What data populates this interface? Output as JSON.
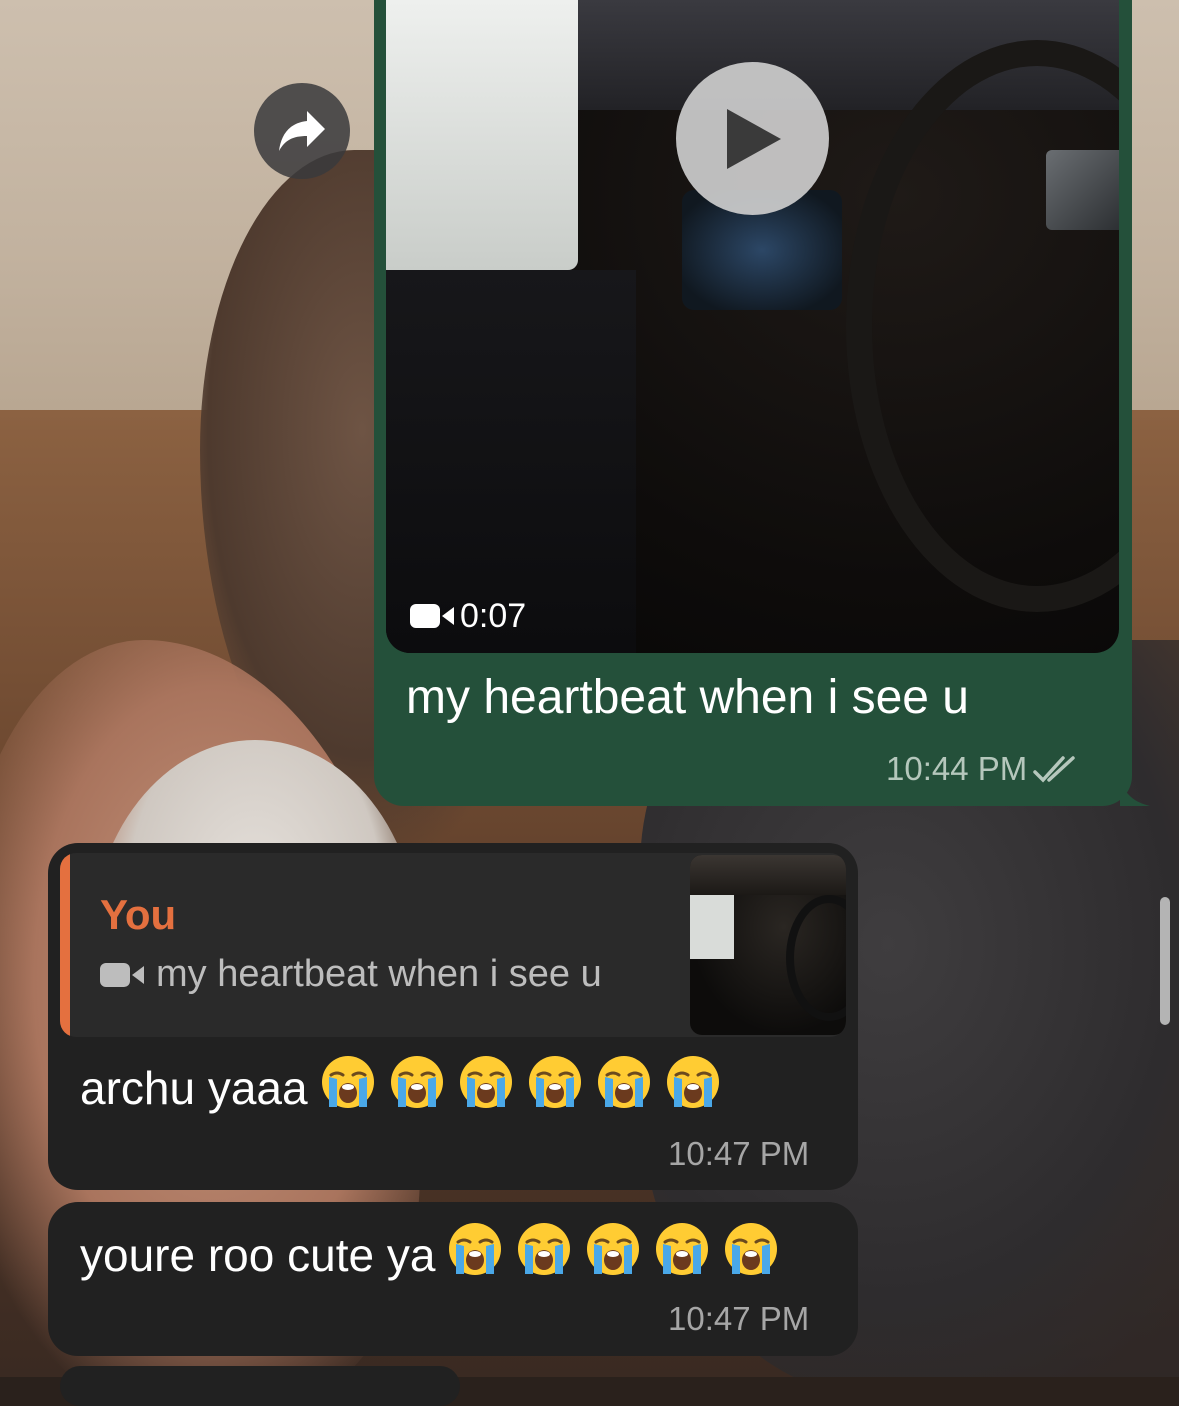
{
  "outgoing": {
    "video_duration": "0:07",
    "caption": "my heartbeat when i see u",
    "time": "10:44 PM",
    "status_icon": "double-check-icon"
  },
  "incoming_1": {
    "reply": {
      "name": "You",
      "media_icon": "video-camera-icon",
      "text": "my heartbeat when i see u"
    },
    "text": "archu yaaa",
    "emoji_count": 6,
    "emoji": "loudly-crying-face",
    "time": "10:47 PM"
  },
  "incoming_2": {
    "text": "youre roo cute ya",
    "emoji_count": 5,
    "emoji": "loudly-crying-face",
    "time": "10:47 PM"
  },
  "colors": {
    "outgoing_bubble": "#24503a",
    "incoming_bubble": "#212121",
    "reply_accent": "#e4703f"
  }
}
